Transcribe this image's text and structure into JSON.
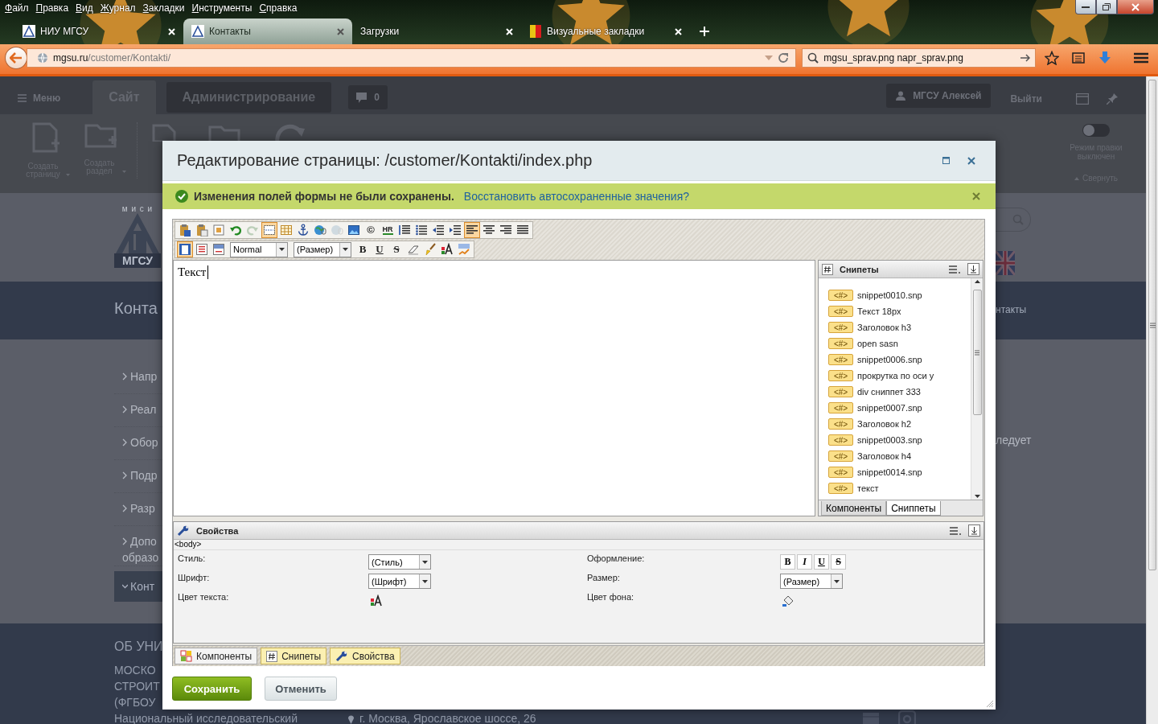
{
  "browser": {
    "menu": [
      "Файл",
      "Правка",
      "Вид",
      "Журнал",
      "Закладки",
      "Инструменты",
      "Справка"
    ],
    "tabs": [
      {
        "title": "НИУ МГСУ",
        "selected": false
      },
      {
        "title": "Контакты",
        "selected": true
      },
      {
        "title": "Загрузки",
        "selected": false
      },
      {
        "title": "Визуальные закладки",
        "selected": false
      }
    ],
    "url": {
      "host": "mgsu.ru",
      "path": "/customer/Kontakti/"
    },
    "search": {
      "value": "mgsu_sprav.png napr_sprav.png"
    }
  },
  "admin_panel": {
    "menu": "Меню",
    "tabs": [
      {
        "label": "Сайт",
        "selected": true
      },
      {
        "label": "Администрирование",
        "selected": false
      }
    ],
    "comments": "0",
    "user": "МГСУ Алексей",
    "logout": "Выйти",
    "actions": [
      {
        "label": "Создать страницу"
      },
      {
        "label": "Создать раздел"
      }
    ],
    "edit_mode": {
      "label": "Режим правки выключен",
      "on": false
    },
    "collapse": "Свернуть"
  },
  "site": {
    "logo": {
      "top": "м и с и",
      "bottom": "МГСУ"
    },
    "page_title": "Конта",
    "breadcrumb": "нтакты",
    "menu": [
      {
        "label": "Напр",
        "selected": false
      },
      {
        "label": "Реал",
        "selected": false
      },
      {
        "label": "Обор",
        "selected": false
      },
      {
        "label": "Подр",
        "selected": false
      },
      {
        "label": "Разр",
        "selected": false
      },
      {
        "label": "Допо образо",
        "selected": false
      },
      {
        "label": "Конт",
        "selected": true
      }
    ],
    "text_fragment": "ледует",
    "footer": {
      "heading": "ОБ УНИ",
      "lines": [
        "МОСКО",
        "СТРОИТ",
        "(ФГБОУ",
        "Национальный исследовательский"
      ],
      "address": "г. Москва, Ярославское шоссе, 26"
    }
  },
  "modal": {
    "title": "Редактирование страницы: /customer/Kontakti/index.php",
    "notice": {
      "message": "Изменения полей формы не были сохранены.",
      "link": "Восстановить автосохраненные значения?"
    },
    "editor": {
      "toolbar": {
        "row1": [
          {
            "selected": false,
            "disabled": false
          },
          {
            "selected": false,
            "disabled": false
          },
          {
            "selected": false,
            "disabled": false
          },
          {
            "selected": false,
            "disabled": false
          },
          {
            "selected": false,
            "disabled": true
          },
          {
            "selected": true,
            "disabled": false
          },
          {
            "selected": false,
            "disabled": false
          },
          {
            "selected": false,
            "disabled": false
          },
          {
            "selected": false,
            "disabled": false
          },
          {
            "selected": false,
            "disabled": true
          },
          {
            "selected": false,
            "disabled": false
          },
          {
            "label": "©",
            "selected": false,
            "disabled": false
          },
          {
            "label": "HR",
            "selected": false,
            "disabled": false
          },
          {
            "selected": false,
            "disabled": false
          },
          {
            "selected": false,
            "disabled": false
          },
          {
            "selected": false,
            "disabled": false
          },
          {
            "selected": false,
            "disabled": false
          },
          {
            "selected": true,
            "disabled": false
          },
          {
            "selected": false,
            "disabled": false
          },
          {
            "selected": false,
            "disabled": false
          },
          {
            "selected": false,
            "disabled": false
          }
        ],
        "row2": [
          {
            "kind": "button",
            "selected": true
          },
          {
            "kind": "button",
            "selected": false
          },
          {
            "kind": "button",
            "selected": false
          },
          {
            "kind": "select",
            "value": "Normal"
          },
          {
            "kind": "select",
            "value": "(Размер)"
          },
          {
            "kind": "button",
            "label": "B",
            "selected": false
          },
          {
            "kind": "button",
            "label": "U",
            "selected": false
          },
          {
            "kind": "button",
            "label": "S",
            "selected": false
          },
          {
            "kind": "button",
            "selected": false
          },
          {
            "kind": "button",
            "selected": false
          },
          {
            "kind": "button",
            "selected": false
          },
          {
            "kind": "button",
            "selected": false
          }
        ]
      },
      "content": "Текст",
      "snippets": {
        "title": "Снипеты",
        "items": [
          {
            "badge": "<#>",
            "label": "snippet0010.snp"
          },
          {
            "badge": "<#>",
            "label": "Текст 18px"
          },
          {
            "badge": "<#>",
            "label": "Заголовок h3"
          },
          {
            "badge": "<#>",
            "label": "open sasn"
          },
          {
            "badge": "<#>",
            "label": "snippet0006.snp"
          },
          {
            "badge": "<#>",
            "label": "прокрутка по оси y"
          },
          {
            "badge": "<#>",
            "label": "div сниппет 333"
          },
          {
            "badge": "<#>",
            "label": "snippet0007.snp"
          },
          {
            "badge": "<#>",
            "label": "Заголовок h2"
          },
          {
            "badge": "<#>",
            "label": "snippet0003.snp"
          },
          {
            "badge": "<#>",
            "label": "Заголовок h4"
          },
          {
            "badge": "<#>",
            "label": "snippet0014.snp"
          },
          {
            "badge": "<#>",
            "label": "текст"
          }
        ],
        "tabs": [
          {
            "label": "Компоненты",
            "selected": false
          },
          {
            "label": "Сниппеты",
            "selected": true
          }
        ]
      },
      "properties": {
        "title": "Свойства",
        "path": "<body>",
        "fields": [
          {
            "kind": "select",
            "label": "Стиль:",
            "value": "(Стиль)"
          },
          {
            "kind": "format",
            "label": "Оформление:",
            "buttons": [
              "B",
              "I",
              "U",
              "S"
            ]
          },
          {
            "kind": "select",
            "label": "Шрифт:",
            "value": "(Шрифт)"
          },
          {
            "kind": "select",
            "label": "Размер:",
            "value": "(Размер)"
          },
          {
            "kind": "color",
            "label": "Цвет текста:"
          },
          {
            "kind": "color",
            "label": "Цвет фона:"
          }
        ]
      },
      "panel_tabs": [
        {
          "label": "Компоненты",
          "selected": false
        },
        {
          "label": "Снипеты",
          "selected": true
        },
        {
          "label": "Свойства",
          "selected": true
        }
      ]
    },
    "buttons": [
      {
        "kind": "primary",
        "label": "Сохранить"
      },
      {
        "kind": "secondary",
        "label": "Отменить"
      }
    ]
  }
}
